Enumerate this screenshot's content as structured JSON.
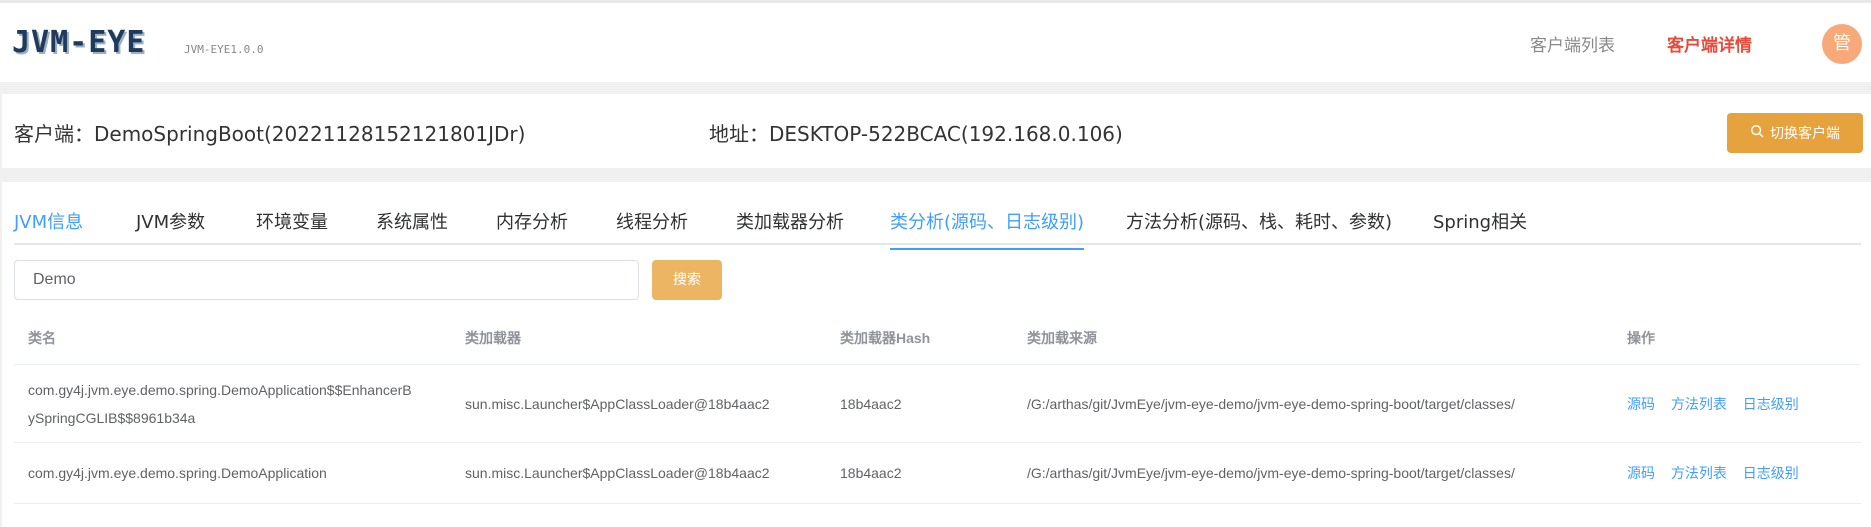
{
  "header": {
    "logo": "JVM-EYE",
    "version": "JVM-EYE1.0.0",
    "nav": {
      "client_list": "客户端列表",
      "client_detail": "客户端详情"
    },
    "avatar_text": "管",
    "active_color": "#e84a3c"
  },
  "client": {
    "name": "客户端：DemoSpringBoot(20221128152121801JDr)",
    "address": "地址：DESKTOP-522BCAC(192.168.0.106)",
    "switch_label": "切换客户端",
    "switch_icon": "search-icon"
  },
  "tabs": [
    {
      "label": "JVM信息"
    },
    {
      "label": "JVM参数"
    },
    {
      "label": "环境变量"
    },
    {
      "label": "系统属性"
    },
    {
      "label": "内存分析"
    },
    {
      "label": "线程分析"
    },
    {
      "label": "类加载器分析"
    },
    {
      "label": "类分析(源码、日志级别)"
    },
    {
      "label": "方法分析(源码、栈、耗时、参数)"
    },
    {
      "label": "Spring相关"
    }
  ],
  "search": {
    "value": "Demo",
    "button": "搜索"
  },
  "table": {
    "headers": [
      "类名",
      "类加载器",
      "类加载器Hash",
      "类加载来源",
      "操作"
    ],
    "rows": [
      {
        "class_name_1": "com.gy4j.jvm.eye.demo.spring.DemoApplication$$EnhancerB",
        "class_name_2": "ySpringCGLIB$$8961b34a",
        "loader": "sun.misc.Launcher$AppClassLoader@18b4aac2",
        "hash": "18b4aac2",
        "source": "/G:/arthas/git/JvmEye/jvm-eye-demo/jvm-eye-demo-spring-boot/target/classes/"
      },
      {
        "class_name": "com.gy4j.jvm.eye.demo.spring.DemoApplication",
        "loader": "sun.misc.Launcher$AppClassLoader@18b4aac2",
        "hash": "18b4aac2",
        "source": "/G:/arthas/git/JvmEye/jvm-eye-demo/jvm-eye-demo-spring-boot/target/classes/"
      }
    ],
    "actions": {
      "source": "源码",
      "methods": "方法列表",
      "log_level": "日志级别"
    }
  }
}
